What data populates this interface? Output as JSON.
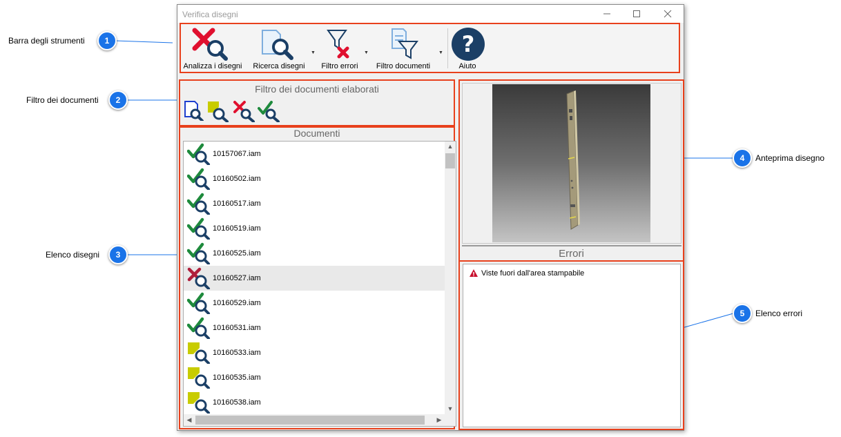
{
  "window": {
    "title": "Verifica disegni"
  },
  "toolbar": {
    "items": [
      {
        "label": "Analizza i disegni",
        "icon": "analyze-icon"
      },
      {
        "label": "Ricerca disegni",
        "icon": "search-drawings-icon"
      },
      {
        "label": "Filtro errori",
        "icon": "filter-errors-icon"
      },
      {
        "label": "Filtro documenti",
        "icon": "filter-documents-icon"
      },
      {
        "label": "Aiuto",
        "icon": "help-icon"
      }
    ]
  },
  "document_filter": {
    "title": "Filtro dei documenti elaborati",
    "icons": [
      "all-documents-icon",
      "unprocessed-documents-icon",
      "error-documents-icon",
      "ok-documents-icon"
    ]
  },
  "documents": {
    "title": "Documenti",
    "items": [
      {
        "name": "10157067.iam",
        "status": "ok"
      },
      {
        "name": "10160502.iam",
        "status": "ok"
      },
      {
        "name": "10160517.iam",
        "status": "ok"
      },
      {
        "name": "10160519.iam",
        "status": "ok"
      },
      {
        "name": "10160525.iam",
        "status": "ok"
      },
      {
        "name": "10160527.iam",
        "status": "error"
      },
      {
        "name": "10160529.iam",
        "status": "ok"
      },
      {
        "name": "10160531.iam",
        "status": "ok"
      },
      {
        "name": "10160533.iam",
        "status": "pending"
      },
      {
        "name": "10160535.iam",
        "status": "pending"
      },
      {
        "name": "10160538.iam",
        "status": "pending"
      }
    ],
    "selected_index": 5
  },
  "errors": {
    "title": "Errori",
    "items": [
      {
        "text": "Viste fuori dall'area stampabile",
        "icon": "warning-icon"
      }
    ]
  },
  "callouts": [
    {
      "number": "1",
      "label": "Barra degli strumenti"
    },
    {
      "number": "2",
      "label": "Filtro dei documenti"
    },
    {
      "number": "3",
      "label": "Elenco disegni"
    },
    {
      "number": "4",
      "label": "Anteprima disegno"
    },
    {
      "number": "5",
      "label": "Elenco errori"
    }
  ],
  "colors": {
    "highlight": "#e8401c",
    "badge": "#1a73e8",
    "ok": "#1e8a3c",
    "error": "#e0102f",
    "magnifier": "#1b3f66"
  }
}
